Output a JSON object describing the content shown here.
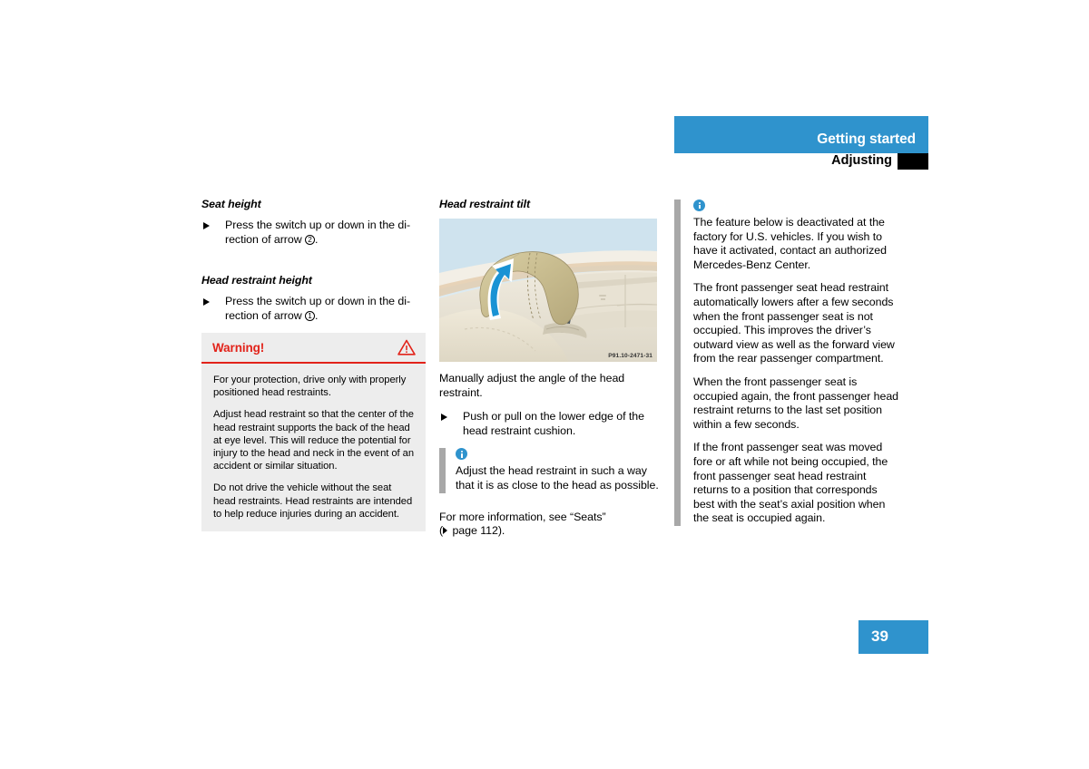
{
  "header": {
    "chapter": "Getting started",
    "section": "Adjusting",
    "bar_color": "#2f93cd",
    "tab_color": "#000000"
  },
  "page_number": "39",
  "left_column": {
    "heading_1": "Seat height",
    "bullet_1_prefix": "Press the switch up or down in the di-rection of arrow ",
    "bullet_1_circle": "2",
    "bullet_1_suffix": ".",
    "heading_2": "Head restraint height",
    "bullet_2_prefix": "Press the switch up or down in the di-rection of arrow ",
    "bullet_2_circle": "1",
    "bullet_2_suffix": ".",
    "warning": {
      "title": "Warning!",
      "icon": "warning-triangle-icon",
      "accent_color": "#e2231a",
      "background_color": "#ededed",
      "paragraphs": [
        "For your protection, drive only with properly positioned head restraints.",
        "Adjust head restraint so that the center of the head restraint supports the back of the head at eye level. This will reduce the potential for injury to the head and neck in the event of an accident or similar situation.",
        "Do not drive the vehicle without the seat head restraints. Head restraints are intended to help reduce injuries during an accident."
      ]
    }
  },
  "middle_column": {
    "heading": "Head restraint tilt",
    "figure": {
      "code": "P91.10-2471-31",
      "alt": "head-restraint-tilt-illustration"
    },
    "intro": "Manually adjust the angle of the head restraint.",
    "bullet": "Push or pull on the lower edge of the head restraint cushion.",
    "note": {
      "icon": "info-icon",
      "text": "Adjust the head restraint in such a way that it is as close to the head as possible."
    },
    "xref_prefix": "For more information, see “Seats”",
    "xref_line2_open": "(",
    "xref_line2_text": " page 112).",
    "xref_icon": "xref-arrow-icon"
  },
  "right_column": {
    "note": {
      "icon": "info-icon",
      "paragraphs": [
        "The feature below is deactivated at the factory for U.S. vehicles. If you wish to have it activated, contact an authorized Mercedes-Benz Center.",
        "The front passenger seat head restraint automatically lowers after a few seconds when the front passenger seat is not occupied. This improves the driver’s outward view as well as the forward view from the rear passenger compartment.",
        "When the front passenger seat is occupied again, the front passenger head restraint returns to the last set position within a few seconds.",
        "If the front passenger seat was moved fore or aft while not being occupied, the front passenger seat head restraint returns to a position that corresponds best with the seat’s axial position when the seat is occupied again."
      ]
    }
  }
}
